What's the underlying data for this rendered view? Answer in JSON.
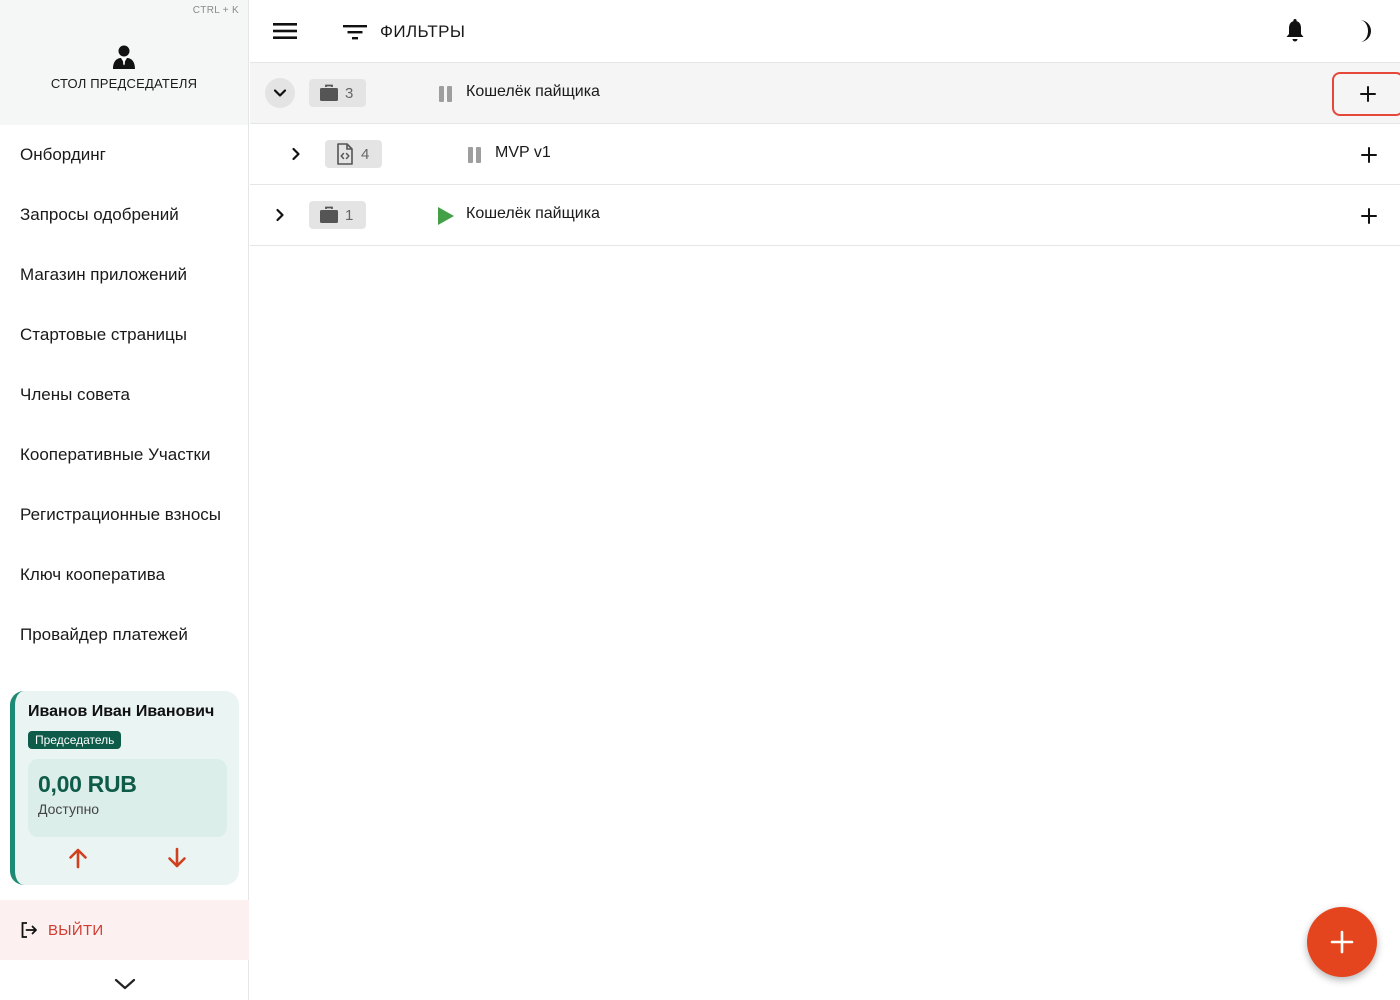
{
  "sidebar": {
    "hotkey": "CTRL + K",
    "title": "СТОЛ ПРЕДСЕДАТЕЛЯ",
    "items": [
      {
        "label": "Онбординг"
      },
      {
        "label": "Запросы одобрений"
      },
      {
        "label": "Магазин приложений"
      },
      {
        "label": "Стартовые страницы"
      },
      {
        "label": "Члены совета"
      },
      {
        "label": "Кооперативные Участки"
      },
      {
        "label": "Регистрационные взносы"
      },
      {
        "label": "Ключ кооператива"
      },
      {
        "label": "Провайдер платежей"
      }
    ],
    "user": {
      "name": "Иванов Иван Иванович",
      "role": "Председатель",
      "balance": "0,00 RUB",
      "balance_label": "Доступно"
    },
    "logout_label": "ВЫЙТИ"
  },
  "header": {
    "filters_label": "ФИЛЬТРЫ"
  },
  "rows": [
    {
      "count": "3",
      "title": "Кошелёк пайщика",
      "status": "paused",
      "expanded": true
    },
    {
      "count": "4",
      "title": "MVP v1",
      "status": "paused",
      "expanded": false
    },
    {
      "count": "1",
      "title": "Кошелёк пайщика",
      "status": "running",
      "expanded": false
    }
  ],
  "colors": {
    "accent_green": "#0e5b4a",
    "danger": "#d03b2e",
    "fab": "#e5451e",
    "play": "#43a047"
  }
}
